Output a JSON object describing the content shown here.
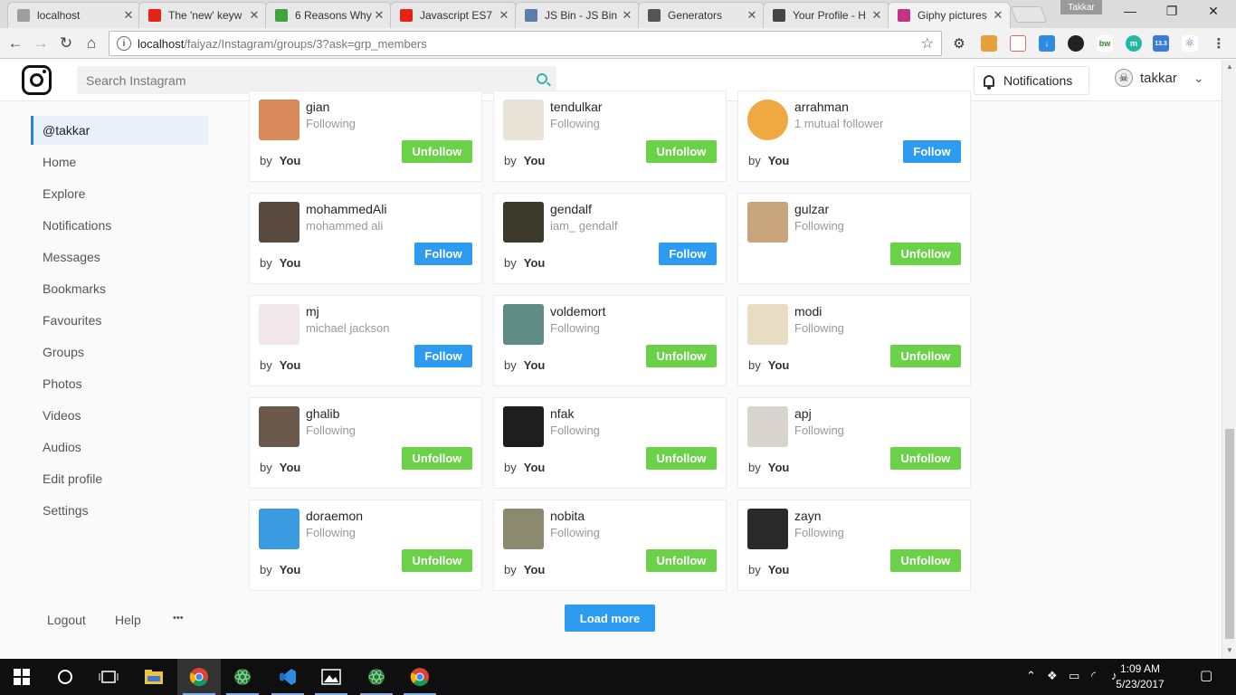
{
  "browser": {
    "tabs": [
      {
        "title": "localhost",
        "favicon": "page-icon",
        "fav_color": "#9e9e9e"
      },
      {
        "title": "The 'new' keyw",
        "favicon": "youtube-icon",
        "fav_color": "#e62117"
      },
      {
        "title": "6 Reasons Why",
        "favicon": "clock-icon",
        "fav_color": "#3fa33f"
      },
      {
        "title": "Javascript ES7",
        "favicon": "youtube-icon",
        "fav_color": "#e62117"
      },
      {
        "title": "JS Bin - JS Bin",
        "favicon": "jsbin-icon",
        "fav_color": "#5a7ea8"
      },
      {
        "title": "Generators",
        "favicon": "codepen-icon",
        "fav_color": "#555555"
      },
      {
        "title": "Your Profile - H",
        "favicon": "hashnode-icon",
        "fav_color": "#444444"
      },
      {
        "title": "Giphy pictures",
        "favicon": "instagram-icon",
        "fav_color": "#c13584"
      }
    ],
    "profile_chip": "Takkar",
    "url_host": "localhost",
    "url_path": "/faiyaz/Instagram/groups/3?ask=grp_members",
    "ext_badge": "13.3"
  },
  "header": {
    "search_placeholder": "Search Instagram",
    "notifications_label": "Notifications",
    "username": "takkar"
  },
  "sidebar": {
    "items": [
      "@takkar",
      "Home",
      "Explore",
      "Notifications",
      "Messages",
      "Bookmarks",
      "Favourites",
      "Groups",
      "Photos",
      "Videos",
      "Audios",
      "Edit profile",
      "Settings"
    ],
    "footer": {
      "logout": "Logout",
      "help": "Help",
      "more": "•••"
    }
  },
  "members": [
    {
      "name": "gian",
      "sub": "Following",
      "by_label": "by",
      "by": "You",
      "button": "Unfollow",
      "avatar_color": "#d88a5a"
    },
    {
      "name": "tendulkar",
      "sub": "Following",
      "by_label": "by",
      "by": "You",
      "button": "Unfollow",
      "avatar_color": "#e9e2d6"
    },
    {
      "name": "arrahman",
      "sub": "1 mutual follower",
      "by_label": "by",
      "by": "You",
      "button": "Follow",
      "avatar_color": "#f0a940"
    },
    {
      "name": "mohammedAli",
      "sub": "mohammed ali",
      "by_label": "by",
      "by": "You",
      "button": "Follow",
      "avatar_color": "#5a4a3e"
    },
    {
      "name": "gendalf",
      "sub": "iam_ gendalf",
      "by_label": "by",
      "by": "You",
      "button": "Follow",
      "avatar_color": "#3b3a2a"
    },
    {
      "name": "gulzar",
      "sub": "Following",
      "by_label": "",
      "by": "",
      "button": "Unfollow",
      "avatar_color": "#c8a57c"
    },
    {
      "name": "mj",
      "sub": "michael jackson",
      "by_label": "by",
      "by": "You",
      "button": "Follow",
      "avatar_color": "#f1e6ea"
    },
    {
      "name": "voldemort",
      "sub": "Following",
      "by_label": "by",
      "by": "You",
      "button": "Unfollow",
      "avatar_color": "#5f8d86"
    },
    {
      "name": "modi",
      "sub": "Following",
      "by_label": "by",
      "by": "You",
      "button": "Unfollow",
      "avatar_color": "#e8dcc4"
    },
    {
      "name": "ghalib",
      "sub": "Following",
      "by_label": "by",
      "by": "You",
      "button": "Unfollow",
      "avatar_color": "#6b5a4b"
    },
    {
      "name": "nfak",
      "sub": "Following",
      "by_label": "by",
      "by": "You",
      "button": "Unfollow",
      "avatar_color": "#1e1e1e"
    },
    {
      "name": "apj",
      "sub": "Following",
      "by_label": "by",
      "by": "You",
      "button": "Unfollow",
      "avatar_color": "#d9d4ce"
    },
    {
      "name": "doraemon",
      "sub": "Following",
      "by_label": "by",
      "by": "You",
      "button": "Unfollow",
      "avatar_color": "#3b9be0"
    },
    {
      "name": "nobita",
      "sub": "Following",
      "by_label": "by",
      "by": "You",
      "button": "Unfollow",
      "avatar_color": "#8c8a6e"
    },
    {
      "name": "zayn",
      "sub": "Following",
      "by_label": "by",
      "by": "You",
      "button": "Unfollow",
      "avatar_color": "#2a2a2a"
    }
  ],
  "load_more": "Load more",
  "taskbar": {
    "time": "1:09 AM",
    "date": "5/23/2017"
  },
  "colors": {
    "follow": "#2d9cf0",
    "unfollow": "#6ad149",
    "sidebar_active_border": "#2f7fcf"
  }
}
